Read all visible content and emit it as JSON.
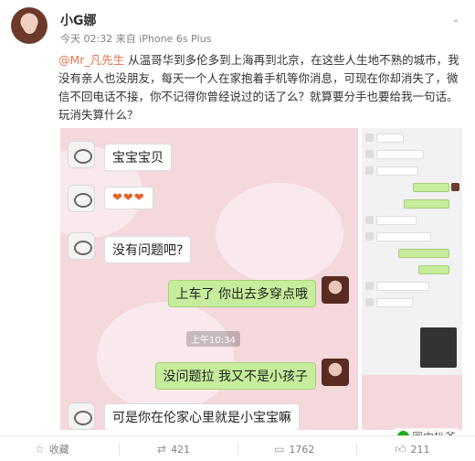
{
  "post": {
    "username": "小G娜",
    "timestamp": "今天 02:32 来自 iPhone 6s Plus",
    "mention": "@Mr_凡先生",
    "text": " 从温哥华到多伦多到上海再到北京，在这些人生地不熟的城市，我没有亲人也没朋友，每天一个人在家抱着手机等你消息，可现在你却消失了，微信不回电话不接，你不记得你曾经说过的话了么？就算要分手也要给我一句话。玩消失算什么？"
  },
  "chat": {
    "messages": [
      {
        "side": "left",
        "text": "宝宝宝贝"
      },
      {
        "side": "left",
        "text": "❤❤❤"
      },
      {
        "side": "left",
        "text": "没有问题吧?"
      },
      {
        "side": "right",
        "text": "上车了 你出去多穿点哦"
      },
      {
        "side": "right",
        "text": "没问题拉 我又不是小孩子"
      },
      {
        "side": "left",
        "text": "可是你在伦家心里就是小宝宝嘛"
      }
    ],
    "time_chip": "上午10:34"
  },
  "footer": {
    "favorite_label": "收藏",
    "repost_count": "421",
    "comment_count": "1762",
    "like_count": "211"
  },
  "watermark": "圈内扒爷",
  "colors": {
    "accent": "#eb7350",
    "bubble_green": "#c6ed9b",
    "chat_bg": "#f4d8dc"
  },
  "icons": {
    "more": "chevron-down-icon",
    "favorite": "star-icon",
    "repost": "repost-icon",
    "comment": "comment-icon",
    "like": "thumbs-up-icon"
  }
}
